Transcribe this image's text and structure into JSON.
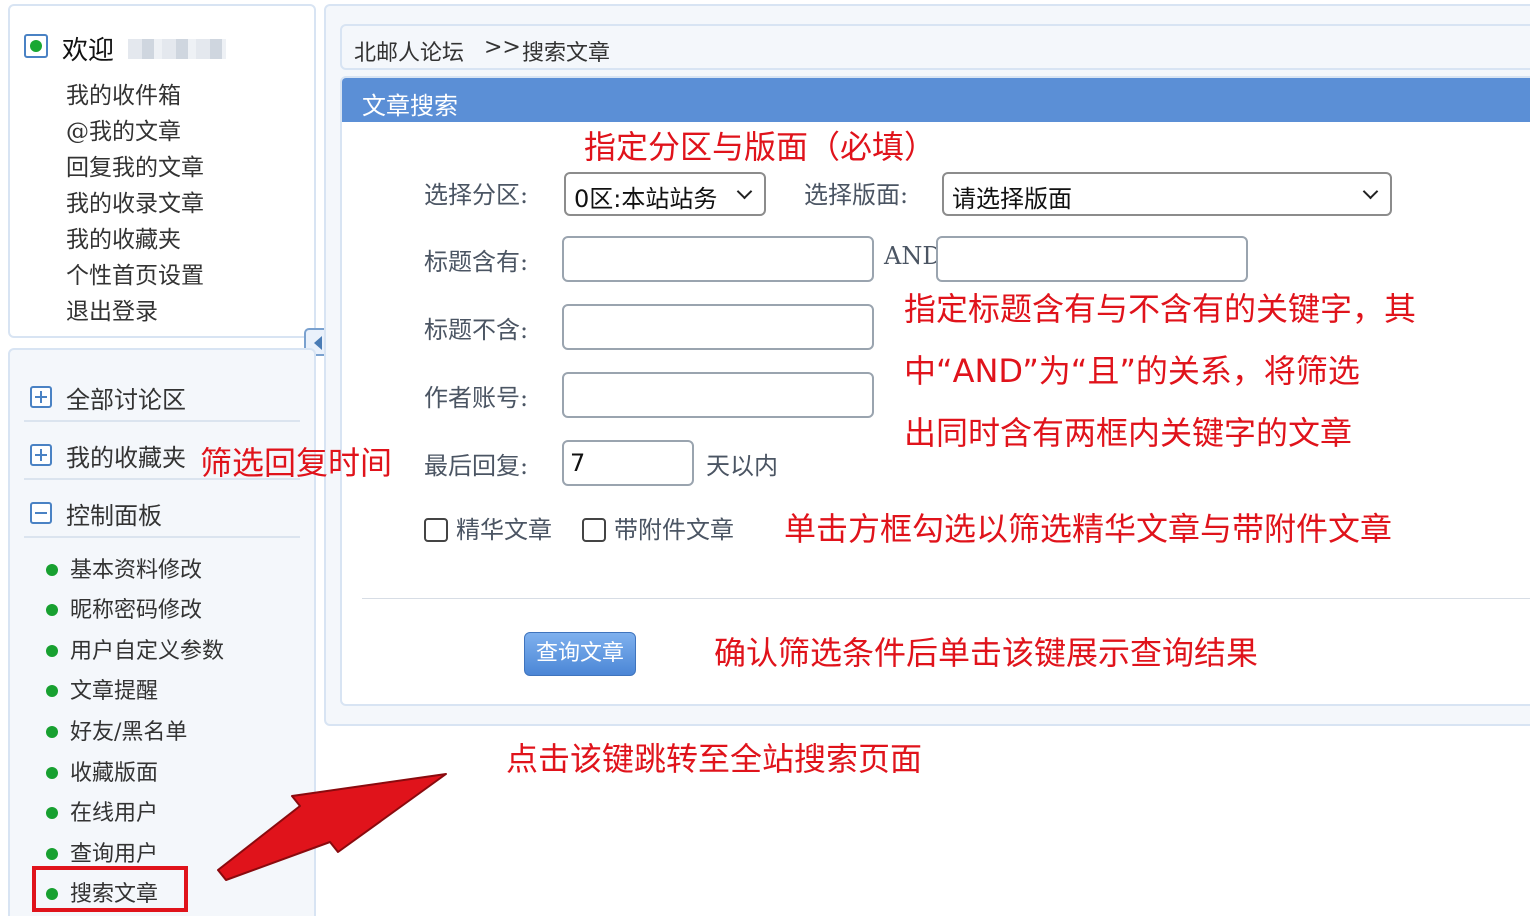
{
  "sidebar": {
    "welcome": "欢迎",
    "links": [
      "我的收件箱",
      "@我的文章",
      "回复我的文章",
      "我的收录文章",
      "我的收藏夹",
      "个性首页设置",
      "退出登录"
    ],
    "groups": [
      "全部讨论区",
      "我的收藏夹",
      "控制面板"
    ],
    "control_items": [
      "基本资料修改",
      "昵称密码修改",
      "用户自定义参数",
      "文章提醒",
      "好友/黑名单",
      "收藏版面",
      "在线用户",
      "查询用户",
      "搜索文章"
    ]
  },
  "breadcrumb": {
    "home": "北邮人论坛",
    "sep": ">>",
    "current": "搜索文章"
  },
  "form": {
    "header": "文章搜索",
    "zone_label": "选择分区:",
    "zone_value": "0区:本站站务",
    "board_label": "选择版面:",
    "board_value": "请选择版面",
    "title_has_label": "标题含有:",
    "and_label": "AND",
    "title_not_label": "标题不含:",
    "author_label": "作者账号:",
    "last_reply_label": "最后回复:",
    "last_reply_value": "7",
    "days_suffix": "天以内",
    "digest_label": "精华文章",
    "attachment_label": "带附件文章",
    "submit_label": "查询文章"
  },
  "annotations": {
    "zone_board": "指定分区与版面（必填）",
    "keywords_line1": "指定标题含有与不含有的关键字，其",
    "keywords_line2": "中“AND”为“且”的关系，将筛选",
    "keywords_line3": "出同时含有两框内关键字的文章",
    "reply_time": "筛选回复时间",
    "checkbox": "单击方框勾选以筛选精华文章与带附件文章",
    "submit": "确认筛选条件后单击该键展示查询结果",
    "sidebar_link": "点击该键跳转至全站搜索页面"
  },
  "colors": {
    "accent": "#5b8fd6",
    "annotation": "#e0131b",
    "online_dot": "#1aa832"
  }
}
